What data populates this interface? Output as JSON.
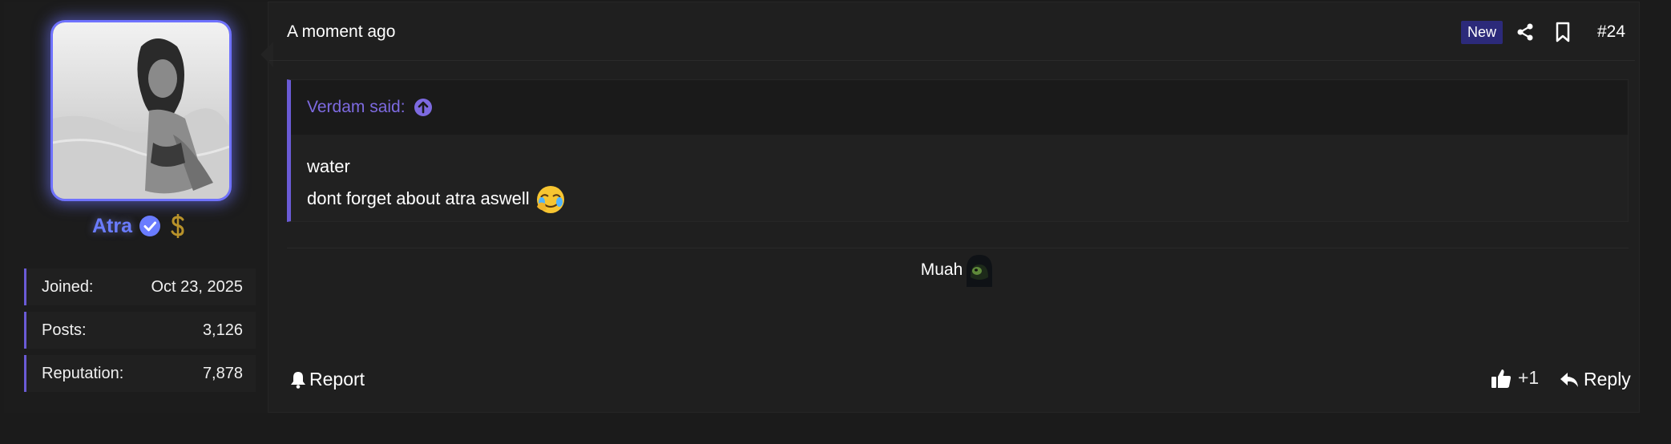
{
  "author": {
    "username": "Atra",
    "badges": [
      "verified-check-icon",
      "dollar-icon"
    ],
    "stats": [
      {
        "label": "Joined:",
        "value": "Oct 23, 2025"
      },
      {
        "label": "Posts:",
        "value": "3,126"
      },
      {
        "label": "Reputation:",
        "value": "7,878"
      }
    ]
  },
  "header": {
    "timestamp": "A moment ago",
    "new_badge": "New",
    "post_number": "#24"
  },
  "quote": {
    "attribution": "Verdam said:",
    "lines": [
      "water",
      "dont forget about atra aswell"
    ],
    "emoji": "face-holding-back-tears-icon"
  },
  "message": {
    "text": "Muah",
    "emoji": "kermit-hooded-icon"
  },
  "actions": {
    "report_label": "Report",
    "like_count": "+1",
    "reply_label": "Reply"
  },
  "colors": {
    "accent": "#6a5bd6",
    "username": "#6a7cff",
    "badge": "#2c2a7a",
    "background": "#1f1f1f"
  }
}
